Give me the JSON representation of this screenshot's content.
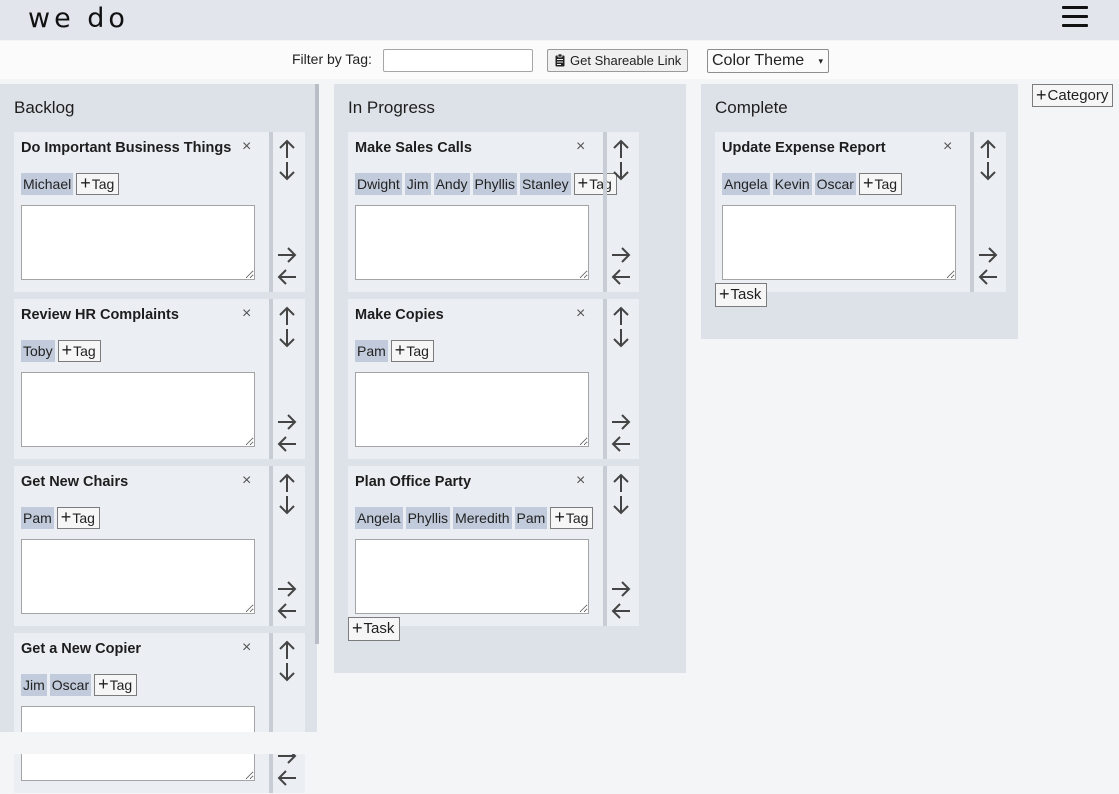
{
  "app": {
    "brand": "we do"
  },
  "toolbar": {
    "filter_label": "Filter by Tag:",
    "filter_value": "",
    "share_label": "Get Shareable Link",
    "theme_label": "Color Theme",
    "theme_caret": "▾"
  },
  "add_category_label": "Category",
  "add_task_label": "Task",
  "add_tag_label": "Tag",
  "close_glyph": "×",
  "columns": [
    {
      "title": "Backlog",
      "cards": [
        {
          "title": "Do Important Business Things",
          "tags": [
            "Michael"
          ]
        },
        {
          "title": "Review HR Complaints",
          "tags": [
            "Toby"
          ]
        },
        {
          "title": "Get New Chairs",
          "tags": [
            "Pam"
          ]
        },
        {
          "title": "Get a New Copier",
          "tags": [
            "Jim",
            "Oscar"
          ]
        }
      ]
    },
    {
      "title": "In Progress",
      "cards": [
        {
          "title": "Make Sales Calls",
          "tags": [
            "Dwight",
            "Jim",
            "Andy",
            "Phyllis",
            "Stanley"
          ]
        },
        {
          "title": "Make Copies",
          "tags": [
            "Pam"
          ]
        },
        {
          "title": "Plan Office Party",
          "tags": [
            "Angela",
            "Phyllis",
            "Meredith",
            "Pam"
          ]
        }
      ]
    },
    {
      "title": "Complete",
      "cards": [
        {
          "title": "Update Expense Report",
          "tags": [
            "Angela",
            "Kevin",
            "Oscar"
          ]
        }
      ]
    }
  ],
  "icons": {
    "menu": "hamburger-icon",
    "share": "clipboard-icon",
    "move": [
      "arrow-up-icon",
      "arrow-down-icon",
      "arrow-right-icon",
      "arrow-left-icon"
    ]
  }
}
